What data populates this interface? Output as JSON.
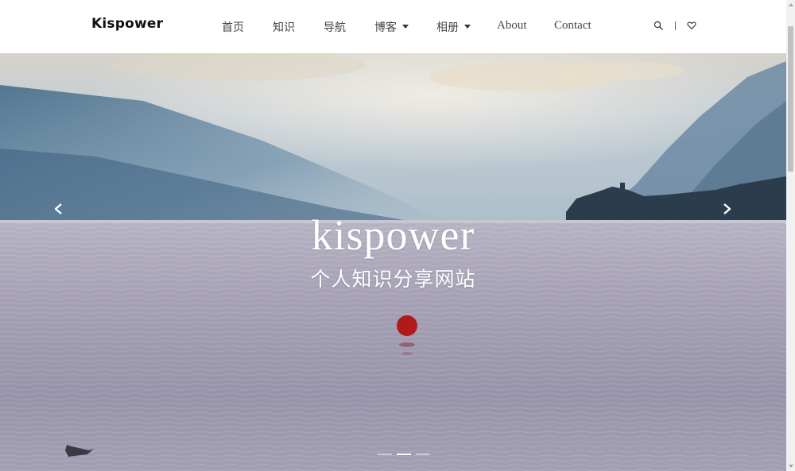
{
  "site": {
    "logo_text": "Kispower"
  },
  "nav": {
    "items": [
      {
        "label": "首页"
      },
      {
        "label": "知识"
      },
      {
        "label": "导航"
      },
      {
        "label": "博客",
        "dropdown": true
      },
      {
        "label": "相册",
        "dropdown": true
      },
      {
        "label": "About"
      },
      {
        "label": "Contact"
      }
    ],
    "icons": [
      "search-icon",
      "heart-icon"
    ]
  },
  "hero": {
    "title": "kispower",
    "subtitle": "个人知识分享网站",
    "slides_count": 3,
    "active_slide": 2
  },
  "colors": {
    "header_bg": "#ffffff",
    "text": "#444444",
    "hero_text": "#ffffff",
    "buoy": "#b01a1a"
  }
}
